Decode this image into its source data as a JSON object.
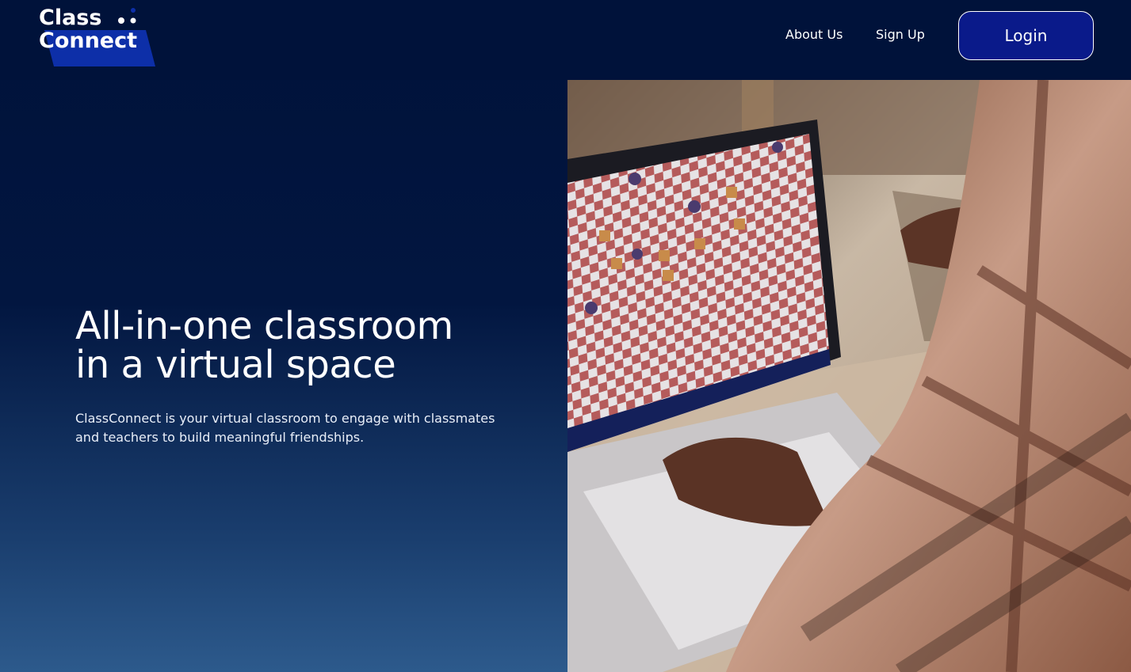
{
  "brand": {
    "logo_line1": "Class",
    "logo_line2": "Connect",
    "logo_icon": "dots-icon"
  },
  "nav": {
    "about_label": "About Us",
    "signup_label": "Sign Up",
    "login_label": "Login"
  },
  "hero": {
    "title_line1": "All-in-one classroom",
    "title_line2": "in a virtual space",
    "subtitle": "ClassConnect is your virtual classroom to engage with classmates and teachers to build meaningful friendships."
  },
  "photo": {
    "subject": "person-using-laptop-image"
  },
  "colors": {
    "background_top": "#00123a",
    "background_bottom": "#2d5a8c",
    "login_button": "#0a1a8a",
    "logo_blue": "#0d2fa8"
  }
}
